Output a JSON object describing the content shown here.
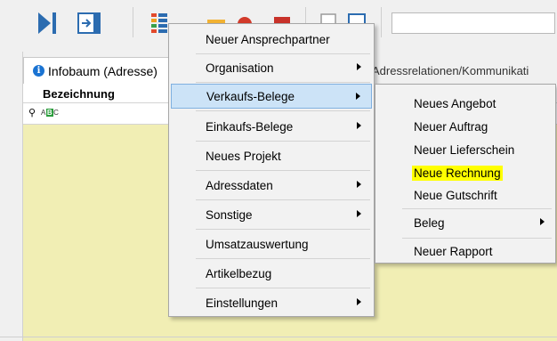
{
  "tabs": {
    "active_label": "Infobaum (Adresse)",
    "right_label": "Adressrelationen/Kommunikati"
  },
  "grid": {
    "column_header": "Bezeichnung",
    "filter_text": "ABC"
  },
  "menu": {
    "items": [
      {
        "label": "Neuer Ansprechpartner",
        "submenu": false
      },
      {
        "label": "Organisation",
        "submenu": true
      },
      {
        "label": "Verkaufs-Belege",
        "submenu": true,
        "selected": true
      },
      {
        "label": "Einkaufs-Belege",
        "submenu": true
      },
      {
        "label": "Neues Projekt",
        "submenu": false
      },
      {
        "label": "Adressdaten",
        "submenu": true
      },
      {
        "label": "Sonstige",
        "submenu": true
      },
      {
        "label": "Umsatzauswertung",
        "submenu": false
      },
      {
        "label": "Artikelbezug",
        "submenu": false
      },
      {
        "label": "Einstellungen",
        "submenu": true
      }
    ]
  },
  "submenu": {
    "items": [
      {
        "label": "Neues Angebot"
      },
      {
        "label": "Neuer Auftrag"
      },
      {
        "label": "Neuer Lieferschein"
      },
      {
        "label": "Neue Rechnung",
        "highlighted": true
      },
      {
        "label": "Neue Gutschrift"
      },
      {
        "label": "Beleg",
        "submenu": true
      },
      {
        "label": "Neuer Rapport"
      }
    ]
  },
  "colors": {
    "grid_background": "#f1eeb4",
    "menu_selection": "#cce3f7",
    "highlight": "#ffff00",
    "accent_blue": "#2c6cb0"
  },
  "icons": [
    "skip-next-icon",
    "exit-panel-icon",
    "report-list-icon",
    "folder-icon",
    "alarm-clock-icon",
    "calendar-icon",
    "document-icon",
    "window-icon",
    "info-icon",
    "pin-icon",
    "abc-filter-icon"
  ]
}
